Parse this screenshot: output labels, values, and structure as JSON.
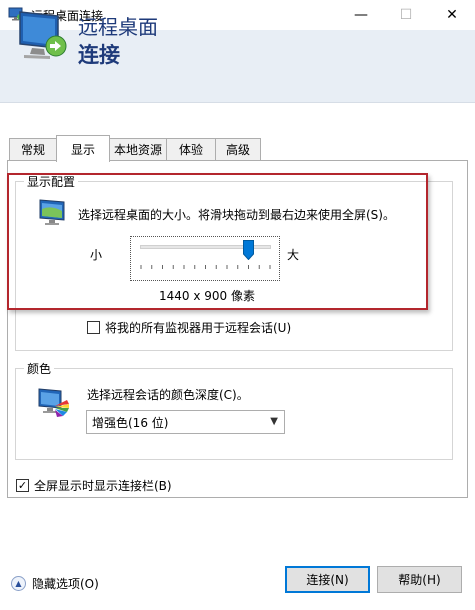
{
  "window": {
    "title": "远程桌面连接",
    "minimize": "—",
    "maximize": "☐",
    "close": "✕"
  },
  "header": {
    "line1": "远程桌面",
    "line2": "连接"
  },
  "tabs": [
    {
      "label": "常规"
    },
    {
      "label": "显示"
    },
    {
      "label": "本地资源"
    },
    {
      "label": "体验"
    },
    {
      "label": "高级"
    }
  ],
  "active_tab": "显示",
  "display_config": {
    "legend": "显示配置",
    "description": "选择远程桌面的大小。将滑块拖动到最右边来使用全屏(S)。",
    "slider_small_label": "小",
    "slider_large_label": "大",
    "slider_level": 0.85,
    "resolution": "1440 x 900 像素",
    "multi_monitor_label": "将我的所有监视器用于远程会话(U)",
    "multi_monitor_checked": false
  },
  "colors": {
    "legend": "颜色",
    "description": "选择远程会话的颜色深度(C)。",
    "selected": "增强色(16 位)"
  },
  "fullscreen_bar": {
    "label": "全屏显示时显示连接栏(B)",
    "checked": true,
    "check_glyph": "✓"
  },
  "footer": {
    "hide_options_label": "隐藏选项(O)",
    "connect_label": "连接(N)",
    "help_label": "帮助(H)"
  },
  "style": {
    "highlight_color": "#b3262d",
    "header_text_color": "#1e3a7a",
    "accent": "#0078d7"
  }
}
